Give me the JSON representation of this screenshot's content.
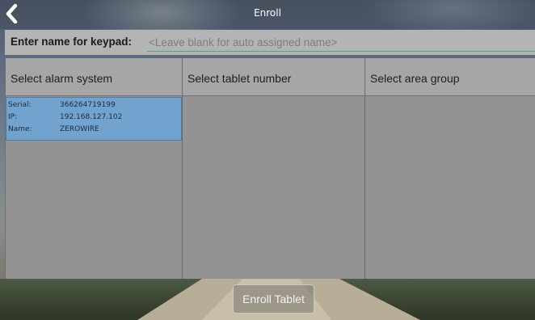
{
  "window": {
    "title": "Enroll"
  },
  "back_icon": "chevron-left-icon",
  "name_entry": {
    "label": "Enter name for keypad:",
    "value": "",
    "placeholder": "<Leave blank for auto assigned name>"
  },
  "columns": {
    "alarm_system": {
      "header": "Select alarm system",
      "items": [
        {
          "serial_label": "Serial:",
          "serial": "366264719199",
          "ip_label": "IP:",
          "ip": "192.168.127.102",
          "name_label": "Name:",
          "name": "ZEROWIRE",
          "selected": true
        }
      ]
    },
    "tablet_number": {
      "header": "Select tablet number",
      "items": []
    },
    "area_group": {
      "header": "Select area group",
      "items": []
    }
  },
  "actions": {
    "enroll_label": "Enroll Tablet"
  },
  "colors": {
    "selection": "#72a3cf",
    "accent_underline": "#4aa79a",
    "title_text": "#ffffff"
  }
}
